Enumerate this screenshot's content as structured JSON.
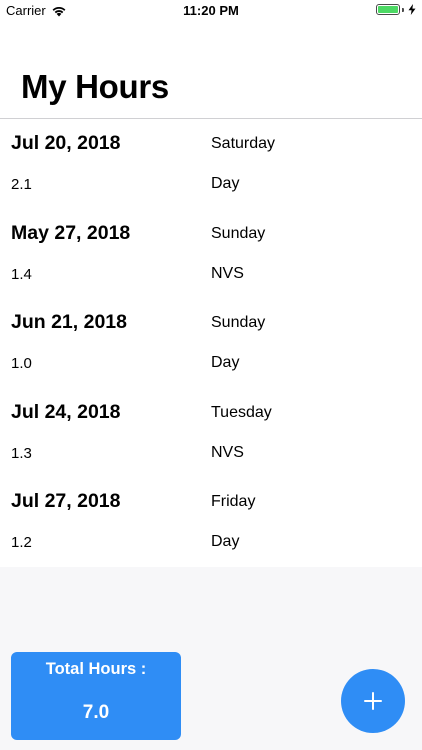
{
  "status_bar": {
    "carrier": "Carrier",
    "time": "11:20 PM",
    "battery_level": 1.0,
    "battery_color": "#4cd964",
    "icons": [
      "wifi-icon",
      "battery-icon",
      "charging-bolt-icon"
    ]
  },
  "page": {
    "title": "My Hours"
  },
  "entries": [
    {
      "date": "Jul 20, 2018",
      "weekday": "Saturday",
      "hours": "2.1",
      "shift": "Day"
    },
    {
      "date": "May 27, 2018",
      "weekday": "Sunday",
      "hours": "1.4",
      "shift": "NVS"
    },
    {
      "date": "Jun 21, 2018",
      "weekday": "Sunday",
      "hours": "1.0",
      "shift": "Day"
    },
    {
      "date": "Jul 24, 2018",
      "weekday": "Tuesday",
      "hours": "1.3",
      "shift": "NVS"
    },
    {
      "date": "Jul 27, 2018",
      "weekday": "Friday",
      "hours": "1.2",
      "shift": "Day"
    }
  ],
  "summary": {
    "total_label": "Total Hours :",
    "total_value": "7.0"
  },
  "actions": {
    "add_icon": "plus-icon"
  },
  "colors": {
    "accent": "#2f8df5",
    "footer_background": "#f7f7f9",
    "divider": "#d0d0d3"
  }
}
